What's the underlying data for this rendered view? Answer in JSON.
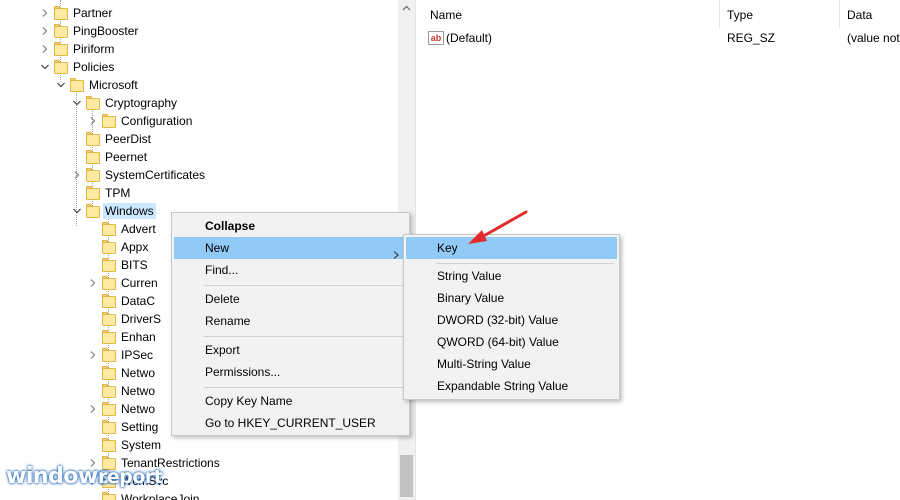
{
  "tree": {
    "items": [
      {
        "label": "Partner",
        "expand": "collapsed"
      },
      {
        "label": "PingBooster",
        "expand": "collapsed"
      },
      {
        "label": "Piriform",
        "expand": "collapsed"
      },
      {
        "label": "Policies",
        "expand": "expanded"
      },
      {
        "label": "Microsoft",
        "expand": "expanded"
      },
      {
        "label": "Cryptography",
        "expand": "expanded"
      },
      {
        "label": "Configuration",
        "expand": "collapsed"
      },
      {
        "label": "PeerDist",
        "expand": "none"
      },
      {
        "label": "Peernet",
        "expand": "none"
      },
      {
        "label": "SystemCertificates",
        "expand": "collapsed"
      },
      {
        "label": "TPM",
        "expand": "none"
      },
      {
        "label": "Windows",
        "expand": "expanded",
        "selected": true
      },
      {
        "label": "Advert",
        "expand": "none"
      },
      {
        "label": "Appx",
        "expand": "none"
      },
      {
        "label": "BITS",
        "expand": "none"
      },
      {
        "label": "Curren",
        "expand": "collapsed"
      },
      {
        "label": "DataC",
        "expand": "none"
      },
      {
        "label": "DriverS",
        "expand": "none"
      },
      {
        "label": "Enhan",
        "expand": "none"
      },
      {
        "label": "IPSec",
        "expand": "collapsed"
      },
      {
        "label": "Netwo",
        "expand": "none"
      },
      {
        "label": "Netwo",
        "expand": "none"
      },
      {
        "label": "Netwo",
        "expand": "collapsed"
      },
      {
        "label": "Setting",
        "expand": "none"
      },
      {
        "label": "System",
        "expand": "none"
      },
      {
        "label": "TenantRestrictions",
        "expand": "collapsed"
      },
      {
        "label": "WcmSvc",
        "expand": "collapsed"
      },
      {
        "label": "WorkplaceJoin",
        "expand": "none"
      }
    ]
  },
  "values_pane": {
    "columns": [
      "Name",
      "Type",
      "Data"
    ],
    "rows": [
      {
        "name": "(Default)",
        "type": "REG_SZ",
        "data": "(value not",
        "icon": "string-value-icon"
      }
    ]
  },
  "context_menu": {
    "collapse": "Collapse",
    "new": "New",
    "find": "Find...",
    "delete": "Delete",
    "rename": "Rename",
    "export": "Export",
    "permissions": "Permissions...",
    "copy_key_name": "Copy Key Name",
    "goto": "Go to HKEY_CURRENT_USER"
  },
  "submenu": {
    "key": "Key",
    "string": "String Value",
    "binary": "Binary Value",
    "dword": "DWORD (32-bit) Value",
    "qword": "QWORD (64-bit) Value",
    "multi": "Multi-String Value",
    "expandable": "Expandable String Value"
  },
  "watermark": {
    "part1": "windows",
    "part2": "report"
  },
  "colors": {
    "selection": "#cce8ff",
    "menu_highlight": "#91c9f7",
    "menu_bg": "#f2f2f2",
    "folder": "#fde9a0",
    "annotation_arrow": "#e32b2b"
  }
}
